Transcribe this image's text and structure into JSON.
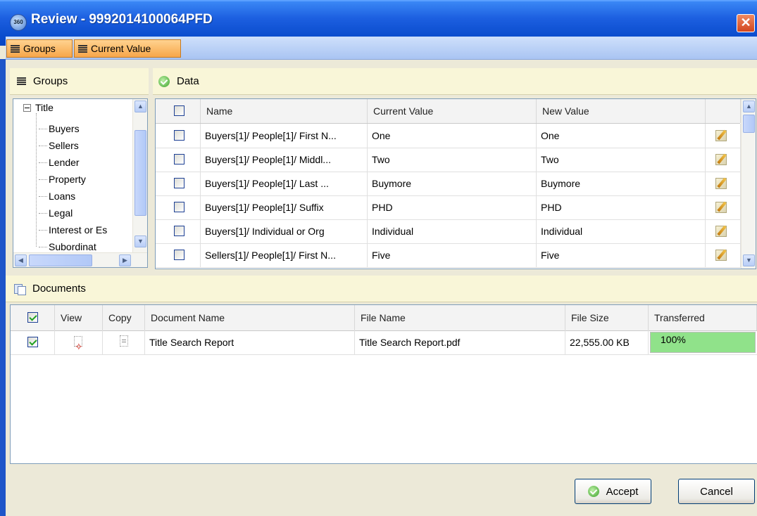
{
  "window": {
    "title": "Review - 9992014100064PFD",
    "app_icon_text": "360",
    "close_icon": "close-icon"
  },
  "toolbar": {
    "groups_label": "Groups",
    "current_value_label": "Current Value"
  },
  "groups_panel": {
    "title": "Groups",
    "root": "Title",
    "items": [
      "Buyers",
      "Sellers",
      "Lender",
      "Property",
      "Loans",
      "Legal",
      "Interest or Es",
      "Subordinat"
    ]
  },
  "data_panel": {
    "title": "Data",
    "columns": {
      "name": "Name",
      "current": "Current Value",
      "new": "New Value"
    },
    "rows": [
      {
        "name": "Buyers[1]/ People[1]/ First N...",
        "current": "One",
        "new": "One"
      },
      {
        "name": "Buyers[1]/ People[1]/ Middl...",
        "current": "Two",
        "new": "Two"
      },
      {
        "name": "Buyers[1]/ People[1]/ Last ...",
        "current": "Buymore",
        "new": "Buymore"
      },
      {
        "name": "Buyers[1]/ People[1]/ Suffix",
        "current": "PHD",
        "new": "PHD"
      },
      {
        "name": "Buyers[1]/ Individual or Org",
        "current": "Individual",
        "new": "Individual"
      },
      {
        "name": "Sellers[1]/ People[1]/ First N...",
        "current": "Five",
        "new": "Five"
      }
    ]
  },
  "documents_panel": {
    "title": "Documents",
    "columns": {
      "view": "View",
      "copy": "Copy",
      "doc_name": "Document Name",
      "file_name": "File Name",
      "file_size": "File Size",
      "transferred": "Transferred"
    },
    "rows": [
      {
        "checked": true,
        "doc_name": "Title Search Report",
        "file_name": "Title Search Report.pdf",
        "file_size": "22,555.00 KB",
        "transferred": "100%",
        "progress": 1.0
      }
    ]
  },
  "buttons": {
    "accept": "Accept",
    "cancel": "Cancel"
  },
  "colors": {
    "title_bar": "#0a4ccd",
    "toolbar_button": "#f7a64a",
    "panel_header": "#f9f6d8",
    "progress_fill": "#90e28a"
  }
}
